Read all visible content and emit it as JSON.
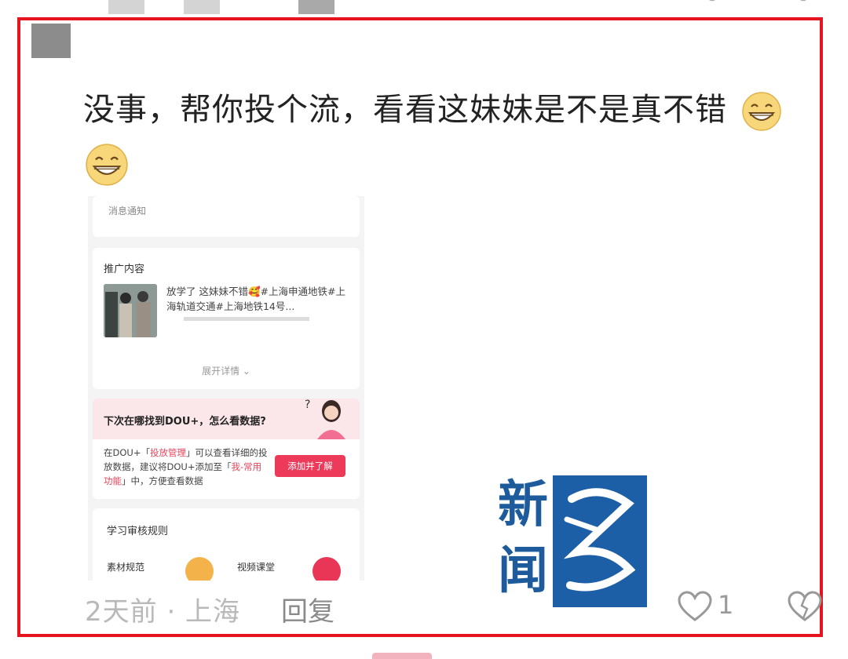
{
  "comment": {
    "text": "没事，帮你投个流，看看这妹妹是不是真不错",
    "emoji_icon": "grinning-face-icon"
  },
  "embedded_screenshot": {
    "notifications_label": "消息通知",
    "promo_heading": "推广内容",
    "promo_text": "放学了 这妹妹不错🥰#上海申通地铁#上海轨道交通#上海地铁14号...",
    "expand_label": "展开详情 ⌄",
    "douplus_title": "下次在哪找到DOU+，怎么看数据?",
    "douplus_body_1": "在DOU+「",
    "douplus_body_hl1": "投放管理",
    "douplus_body_2": "」可以查看详细的投放数据，建议将DOU+添加至「",
    "douplus_body_hl2": "我-常用功能",
    "douplus_body_3": "」中，方便查看数据",
    "douplus_button": "添加并了解",
    "rules_heading": "学习审核规则",
    "rule_item_1": "素材规范",
    "rule_item_2": "视频课堂"
  },
  "footer": {
    "time_location": "2天前 · 上海",
    "reply_label": "回复",
    "like_count": "1"
  },
  "watermark": {
    "text_1": "新",
    "text_2": "闻",
    "text_3": "坊"
  },
  "colors": {
    "frame": "#e5141f",
    "accent": "#ee3a5a",
    "logo_blue": "#1d5fa6"
  }
}
